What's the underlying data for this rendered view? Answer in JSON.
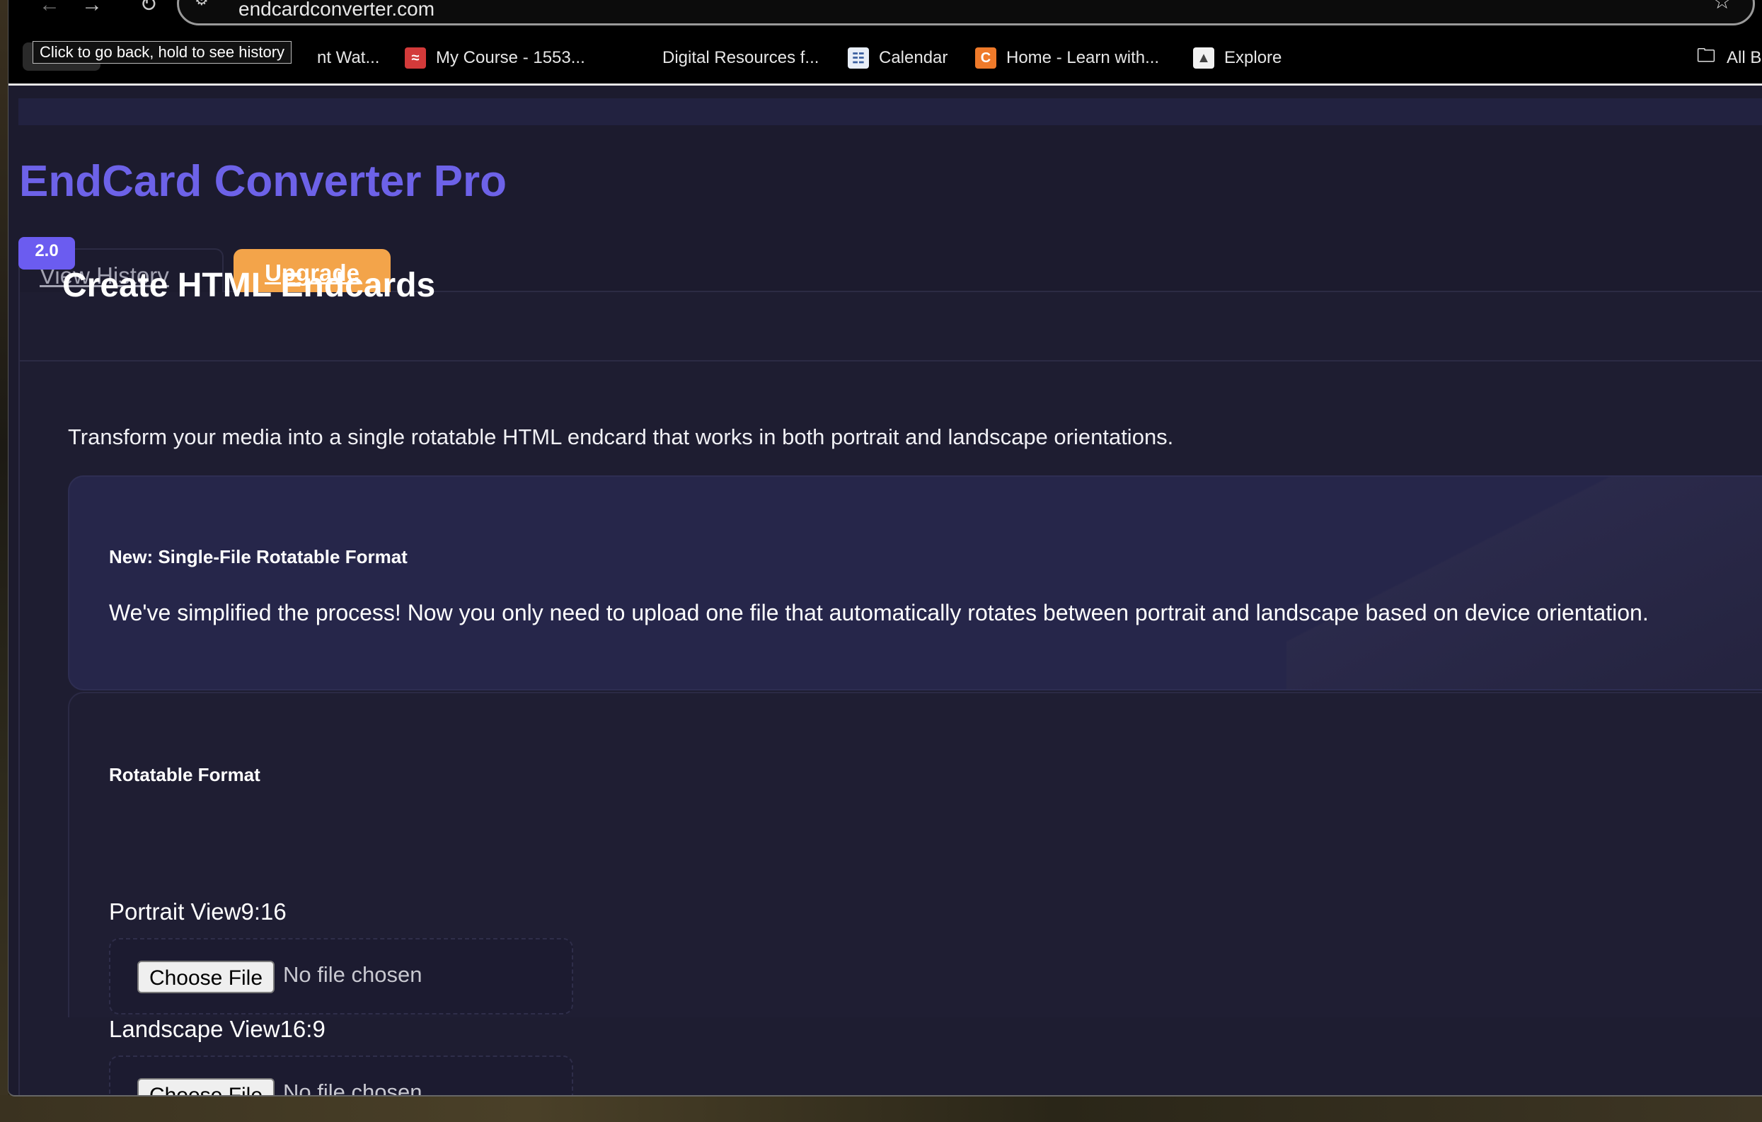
{
  "browser": {
    "url": "endcardconverter.com",
    "tooltip": "Click to go back, hold to see history",
    "bookmarks": [
      {
        "label": "nt Wat...",
        "icon": "bookmark-partial"
      },
      {
        "label": "My Course - 1553...",
        "icon": "course-icon"
      },
      {
        "label": "Digital Resources f...",
        "icon": ""
      },
      {
        "label": "Calendar",
        "icon": "calendar-icon"
      },
      {
        "label": "Home - Learn with...",
        "icon": "c-logo-icon"
      },
      {
        "label": "Explore",
        "icon": "explore-icon"
      },
      {
        "label": "All B",
        "icon": "folder-icon"
      }
    ]
  },
  "app": {
    "title": "EndCard Converter Pro",
    "version": "2.0",
    "tabs": {
      "history": "View History",
      "upgrade": "Upgrade"
    },
    "accent_color": "#6d62e8",
    "upgrade_color": "#f3a44a"
  },
  "card": {
    "title": "Create HTML Endcards",
    "intro": "Transform your media into a single rotatable HTML endcard that works in both portrait and landscape orientations.",
    "notice": {
      "title": "New: Single-File Rotatable Format",
      "body": "We've simplified the process! Now you only need to upload one file that automatically rotates between portrait and landscape based on device orientation."
    },
    "section": {
      "title": "Rotatable Format",
      "fields": [
        {
          "label": "Portrait View9:16",
          "button": "Choose File",
          "status": "No file chosen"
        },
        {
          "label": "Landscape View16:9",
          "button": "Choose File",
          "status": "No file chosen"
        }
      ]
    }
  }
}
